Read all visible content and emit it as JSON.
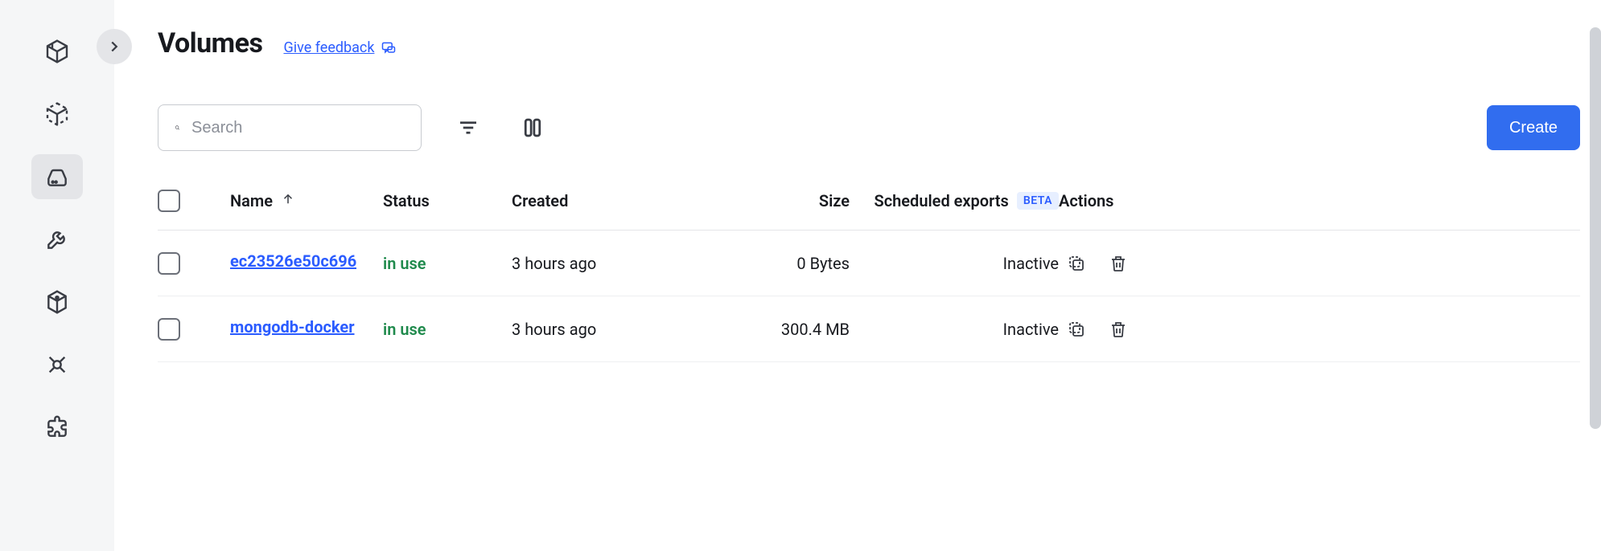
{
  "sidebar": {
    "items": [
      {
        "name": "containers"
      },
      {
        "name": "images"
      },
      {
        "name": "volumes"
      },
      {
        "name": "dev"
      },
      {
        "name": "builds"
      },
      {
        "name": "discover"
      },
      {
        "name": "extensions"
      }
    ],
    "active_index": 2
  },
  "header": {
    "title": "Volumes",
    "feedback_label": "Give feedback"
  },
  "toolbar": {
    "search_placeholder": "Search",
    "create_label": "Create"
  },
  "table": {
    "columns": {
      "name": "Name",
      "status": "Status",
      "created": "Created",
      "size": "Size",
      "scheduled_exports": "Scheduled exports",
      "scheduled_exports_badge": "BETA",
      "actions": "Actions"
    },
    "sort": {
      "column": "name",
      "direction": "asc"
    },
    "rows": [
      {
        "name": "ec23526e50c696",
        "status": "in use",
        "created": "3 hours ago",
        "size": "0 Bytes",
        "scheduled_exports": "Inactive"
      },
      {
        "name": "mongodb-docker",
        "status": "in use",
        "created": "3 hours ago",
        "size": "300.4 MB",
        "scheduled_exports": "Inactive"
      }
    ]
  }
}
